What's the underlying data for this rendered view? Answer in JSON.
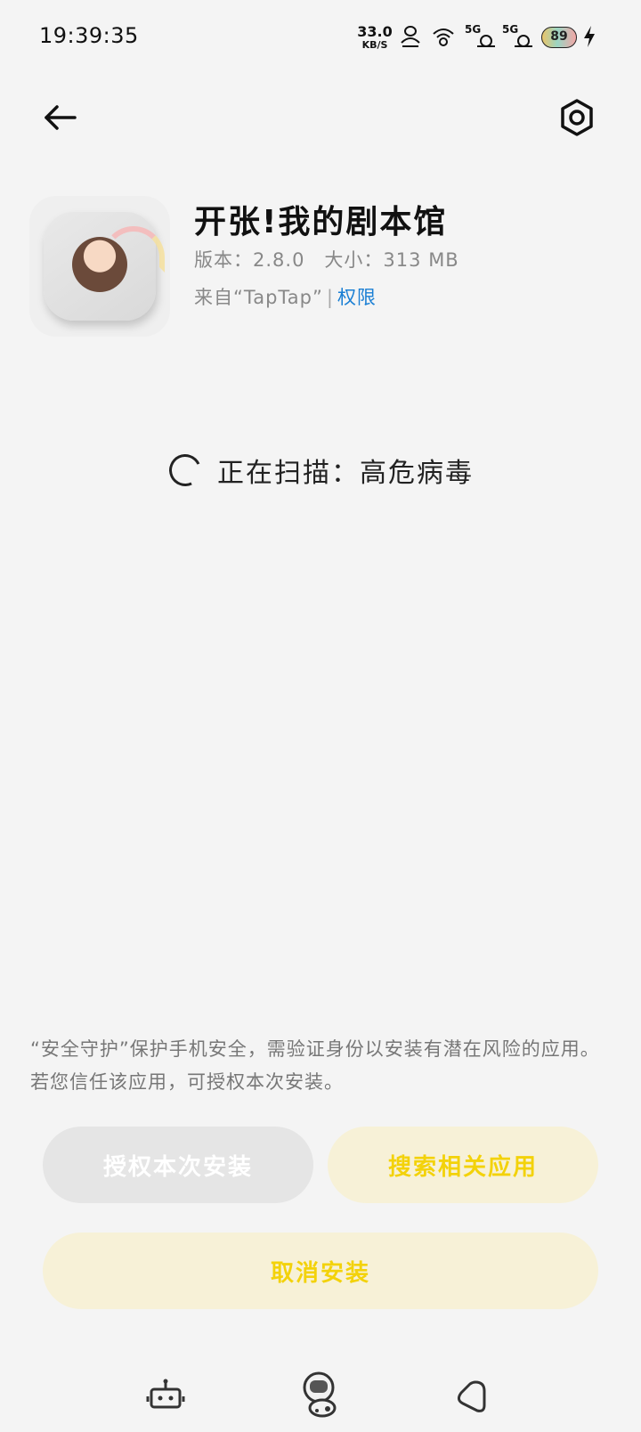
{
  "status_bar": {
    "time": "19:39:35",
    "net_speed_value": "33.0",
    "net_speed_unit": "KB/S",
    "signal_1_label": "5G",
    "signal_2_label": "5G",
    "battery_level": "89",
    "icons": [
      "hotspot-icon",
      "wifi-icon",
      "signal-icon",
      "signal-icon",
      "battery-icon",
      "charging-icon"
    ]
  },
  "header": {
    "back_icon": "arrow-left-icon",
    "settings_icon": "hexagon-gear-icon"
  },
  "app": {
    "name": "开张!我的剧本馆",
    "version_line": "版本：2.8.0　大小：313 MB",
    "source_prefix": "来自“TapTap”",
    "separator": "|",
    "permission_label": "权限"
  },
  "scan": {
    "status": "正在扫描：高危病毒"
  },
  "notice": {
    "text": "“安全守护”保护手机安全，需验证身份以安装有潜在风险的应用。若您信任该应用，可授权本次安装。"
  },
  "actions": {
    "authorize_label": "授权本次安装",
    "search_label": "搜索相关应用",
    "cancel_label": "取消安装"
  },
  "colors": {
    "accent_text": "#f3d20a",
    "accent_bg": "#f7f1d7",
    "link": "#1a7fd4",
    "background": "#f4f4f4"
  },
  "nav": {
    "icons": [
      "robot-icon",
      "astronaut-icon",
      "heart-back-icon"
    ]
  }
}
